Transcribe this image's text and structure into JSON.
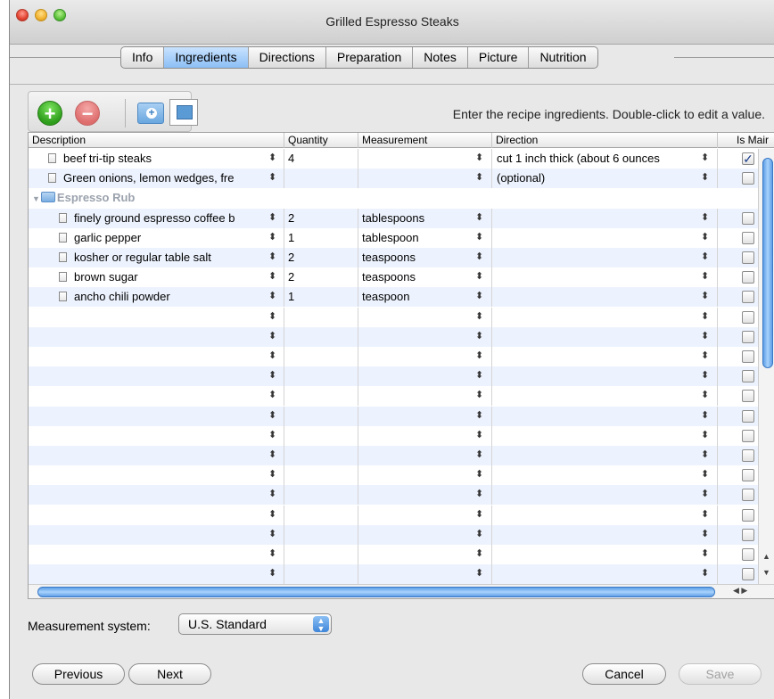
{
  "window": {
    "title": "Grilled Espresso Steaks"
  },
  "tabs": [
    {
      "label": "Info"
    },
    {
      "label": "Ingredients",
      "active": true
    },
    {
      "label": "Directions"
    },
    {
      "label": "Preparation"
    },
    {
      "label": "Notes"
    },
    {
      "label": "Picture"
    },
    {
      "label": "Nutrition"
    }
  ],
  "toolbar": {
    "hint": "Enter the recipe ingredients. Double-click to edit a value."
  },
  "table": {
    "headers": {
      "description": "Description",
      "quantity": "Quantity",
      "measurement": "Measurement",
      "direction": "Direction",
      "is_main": "Is Mair"
    },
    "rows": [
      {
        "description": "beef tri-tip steaks",
        "quantity": "4",
        "measurement": "",
        "direction": "cut 1 inch thick (about 6 ounces",
        "is_main": true
      },
      {
        "description": "Green onions, lemon wedges, fre",
        "quantity": "",
        "measurement": "",
        "direction": "(optional)",
        "is_main": false
      },
      {
        "group": "Espresso Rub"
      },
      {
        "description": "finely ground espresso coffee b",
        "quantity": "2",
        "measurement": "tablespoons",
        "direction": "",
        "is_main": false
      },
      {
        "description": "garlic pepper",
        "quantity": "1",
        "measurement": "tablespoon",
        "direction": "",
        "is_main": false
      },
      {
        "description": "kosher or regular table salt",
        "quantity": "2",
        "measurement": "teaspoons",
        "direction": "",
        "is_main": false
      },
      {
        "description": "brown sugar",
        "quantity": "2",
        "measurement": "teaspoons",
        "direction": "",
        "is_main": false
      },
      {
        "description": "ancho chili powder",
        "quantity": "1",
        "measurement": "teaspoon",
        "direction": "",
        "is_main": false
      }
    ],
    "empty_rows": 14
  },
  "measurement_system": {
    "label": "Measurement system:",
    "value": "U.S. Standard"
  },
  "buttons": {
    "previous": "Previous",
    "next": "Next",
    "cancel": "Cancel",
    "save": "Save"
  },
  "colors": {
    "selection_blue": "#8bbef5",
    "alt_row": "#edf3fe",
    "add_green": "#2d9d1b",
    "remove_red": "#de6d6d"
  }
}
